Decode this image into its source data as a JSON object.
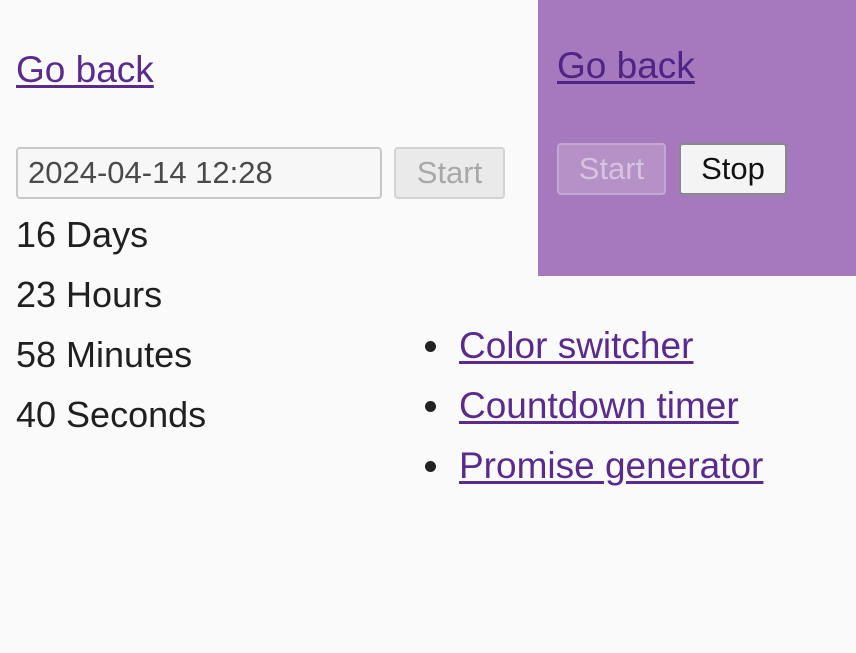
{
  "timer_panel": {
    "back_link": "Go back",
    "date_input_value": "2024-04-14 12:28",
    "start_button": "Start",
    "days": "16 Days",
    "hours": "23 Hours",
    "minutes": "58 Minutes",
    "seconds": "40 Seconds"
  },
  "color_switcher_panel": {
    "background_color": "#a678bd",
    "back_link": "Go back",
    "start_button": "Start",
    "stop_button": "Stop"
  },
  "nav": {
    "items": [
      {
        "label": "Color switcher"
      },
      {
        "label": "Countdown timer"
      },
      {
        "label": "Promise generator"
      }
    ]
  },
  "colors": {
    "link": "#5a2a8f",
    "page_background": "#fafafa"
  }
}
